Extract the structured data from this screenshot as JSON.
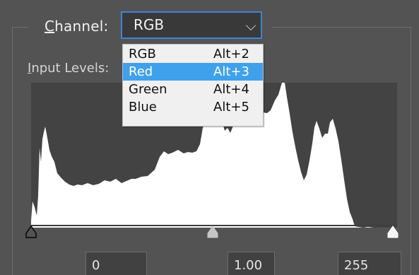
{
  "dialog": {
    "channel_label": "Channel:",
    "selected_channel": "RGB",
    "input_levels_label": "Input Levels:",
    "input_values": {
      "black": "0",
      "gamma": "1.00",
      "white": "255"
    },
    "slider_levels": {
      "black": 0,
      "gamma": 1.0,
      "white": 255
    }
  },
  "channel_menu": {
    "items": [
      {
        "label": "RGB",
        "shortcut": "Alt+2",
        "state": "normal"
      },
      {
        "label": "Red",
        "shortcut": "Alt+3",
        "state": "highlighted"
      },
      {
        "label": "Green",
        "shortcut": "Alt+4",
        "state": "normal"
      },
      {
        "label": "Blue",
        "shortcut": "Alt+5",
        "state": "normal"
      }
    ]
  },
  "colors": {
    "panel_background": "#535353",
    "histogram_background": "#434343",
    "histogram_fill": "#ffffff",
    "selection_highlight": "#3fa1ec",
    "select_border": "#3f83d6"
  },
  "icons": {
    "dropdown_arrow": "chevron-down-icon",
    "black_point": "black-point-slider-icon",
    "gamma_point": "gamma-slider-icon",
    "white_point": "white-point-slider-icon"
  }
}
